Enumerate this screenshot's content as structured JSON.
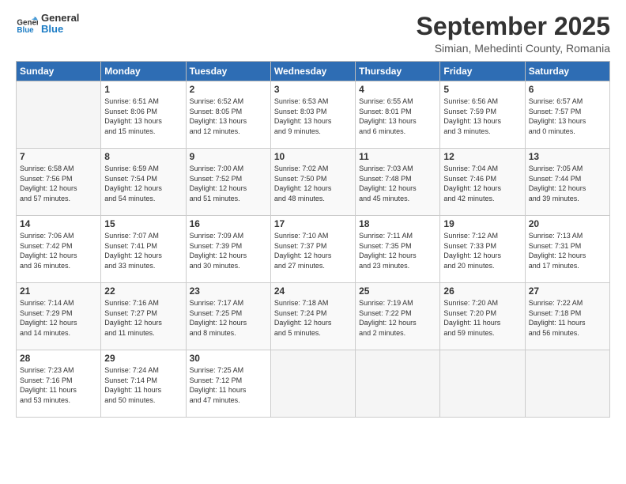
{
  "logo": {
    "line1": "General",
    "line2": "Blue"
  },
  "title": "September 2025",
  "subtitle": "Simian, Mehedinti County, Romania",
  "weekdays": [
    "Sunday",
    "Monday",
    "Tuesday",
    "Wednesday",
    "Thursday",
    "Friday",
    "Saturday"
  ],
  "weeks": [
    [
      {
        "day": "",
        "info": ""
      },
      {
        "day": "1",
        "info": "Sunrise: 6:51 AM\nSunset: 8:06 PM\nDaylight: 13 hours\nand 15 minutes."
      },
      {
        "day": "2",
        "info": "Sunrise: 6:52 AM\nSunset: 8:05 PM\nDaylight: 13 hours\nand 12 minutes."
      },
      {
        "day": "3",
        "info": "Sunrise: 6:53 AM\nSunset: 8:03 PM\nDaylight: 13 hours\nand 9 minutes."
      },
      {
        "day": "4",
        "info": "Sunrise: 6:55 AM\nSunset: 8:01 PM\nDaylight: 13 hours\nand 6 minutes."
      },
      {
        "day": "5",
        "info": "Sunrise: 6:56 AM\nSunset: 7:59 PM\nDaylight: 13 hours\nand 3 minutes."
      },
      {
        "day": "6",
        "info": "Sunrise: 6:57 AM\nSunset: 7:57 PM\nDaylight: 13 hours\nand 0 minutes."
      }
    ],
    [
      {
        "day": "7",
        "info": "Sunrise: 6:58 AM\nSunset: 7:56 PM\nDaylight: 12 hours\nand 57 minutes."
      },
      {
        "day": "8",
        "info": "Sunrise: 6:59 AM\nSunset: 7:54 PM\nDaylight: 12 hours\nand 54 minutes."
      },
      {
        "day": "9",
        "info": "Sunrise: 7:00 AM\nSunset: 7:52 PM\nDaylight: 12 hours\nand 51 minutes."
      },
      {
        "day": "10",
        "info": "Sunrise: 7:02 AM\nSunset: 7:50 PM\nDaylight: 12 hours\nand 48 minutes."
      },
      {
        "day": "11",
        "info": "Sunrise: 7:03 AM\nSunset: 7:48 PM\nDaylight: 12 hours\nand 45 minutes."
      },
      {
        "day": "12",
        "info": "Sunrise: 7:04 AM\nSunset: 7:46 PM\nDaylight: 12 hours\nand 42 minutes."
      },
      {
        "day": "13",
        "info": "Sunrise: 7:05 AM\nSunset: 7:44 PM\nDaylight: 12 hours\nand 39 minutes."
      }
    ],
    [
      {
        "day": "14",
        "info": "Sunrise: 7:06 AM\nSunset: 7:42 PM\nDaylight: 12 hours\nand 36 minutes."
      },
      {
        "day": "15",
        "info": "Sunrise: 7:07 AM\nSunset: 7:41 PM\nDaylight: 12 hours\nand 33 minutes."
      },
      {
        "day": "16",
        "info": "Sunrise: 7:09 AM\nSunset: 7:39 PM\nDaylight: 12 hours\nand 30 minutes."
      },
      {
        "day": "17",
        "info": "Sunrise: 7:10 AM\nSunset: 7:37 PM\nDaylight: 12 hours\nand 27 minutes."
      },
      {
        "day": "18",
        "info": "Sunrise: 7:11 AM\nSunset: 7:35 PM\nDaylight: 12 hours\nand 23 minutes."
      },
      {
        "day": "19",
        "info": "Sunrise: 7:12 AM\nSunset: 7:33 PM\nDaylight: 12 hours\nand 20 minutes."
      },
      {
        "day": "20",
        "info": "Sunrise: 7:13 AM\nSunset: 7:31 PM\nDaylight: 12 hours\nand 17 minutes."
      }
    ],
    [
      {
        "day": "21",
        "info": "Sunrise: 7:14 AM\nSunset: 7:29 PM\nDaylight: 12 hours\nand 14 minutes."
      },
      {
        "day": "22",
        "info": "Sunrise: 7:16 AM\nSunset: 7:27 PM\nDaylight: 12 hours\nand 11 minutes."
      },
      {
        "day": "23",
        "info": "Sunrise: 7:17 AM\nSunset: 7:25 PM\nDaylight: 12 hours\nand 8 minutes."
      },
      {
        "day": "24",
        "info": "Sunrise: 7:18 AM\nSunset: 7:24 PM\nDaylight: 12 hours\nand 5 minutes."
      },
      {
        "day": "25",
        "info": "Sunrise: 7:19 AM\nSunset: 7:22 PM\nDaylight: 12 hours\nand 2 minutes."
      },
      {
        "day": "26",
        "info": "Sunrise: 7:20 AM\nSunset: 7:20 PM\nDaylight: 11 hours\nand 59 minutes."
      },
      {
        "day": "27",
        "info": "Sunrise: 7:22 AM\nSunset: 7:18 PM\nDaylight: 11 hours\nand 56 minutes."
      }
    ],
    [
      {
        "day": "28",
        "info": "Sunrise: 7:23 AM\nSunset: 7:16 PM\nDaylight: 11 hours\nand 53 minutes."
      },
      {
        "day": "29",
        "info": "Sunrise: 7:24 AM\nSunset: 7:14 PM\nDaylight: 11 hours\nand 50 minutes."
      },
      {
        "day": "30",
        "info": "Sunrise: 7:25 AM\nSunset: 7:12 PM\nDaylight: 11 hours\nand 47 minutes."
      },
      {
        "day": "",
        "info": ""
      },
      {
        "day": "",
        "info": ""
      },
      {
        "day": "",
        "info": ""
      },
      {
        "day": "",
        "info": ""
      }
    ]
  ]
}
